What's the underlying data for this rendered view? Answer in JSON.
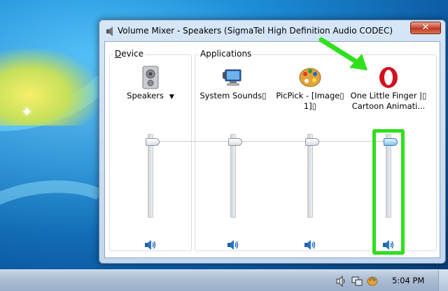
{
  "window": {
    "title": "Volume Mixer - Speakers (SigmaTel High Definition Audio CODEC)",
    "close_label": "✕"
  },
  "device": {
    "group_label_prefix": "D",
    "group_label_rest": "evice",
    "name": "Speakers",
    "dropdown_arrow": "▼",
    "volume_level": 1.0,
    "muted": false
  },
  "applications": {
    "group_label": "Applications",
    "items": [
      {
        "name_line1": "System Sounds▯",
        "name_line2": "",
        "icon": "system-sounds-icon",
        "volume_level": 1.0
      },
      {
        "name_line1": "PicPick - [Image▯",
        "name_line2": "1]▯",
        "icon": "picpick-icon",
        "volume_level": 1.0
      },
      {
        "name_line1": "One Little Finger |▯",
        "name_line2": "Cartoon Animati...",
        "icon": "opera-icon",
        "volume_level": 1.0
      }
    ]
  },
  "taskbar": {
    "clock": "5:04 PM"
  },
  "colors": {
    "highlight": "#2fe01d",
    "opera_red": "#d4101e"
  }
}
